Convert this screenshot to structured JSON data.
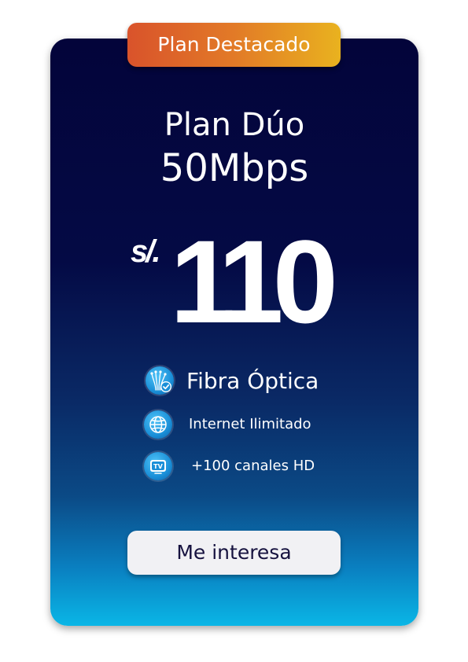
{
  "badge": {
    "label": "Plan Destacado"
  },
  "plan": {
    "name": "Plan Dúo",
    "speed": "50Mbps",
    "currency": "s/.",
    "price": "110"
  },
  "features": [
    {
      "icon": "fiber-optic-icon",
      "label": "Fibra Óptica"
    },
    {
      "icon": "globe-icon",
      "label": "Internet Ilimitado"
    },
    {
      "icon": "tv-icon",
      "label": "+100 canales HD"
    }
  ],
  "cta": {
    "label": "Me interesa"
  },
  "colors": {
    "card_top": "#03043a",
    "card_bottom": "#0ab6e6",
    "badge_start": "#d9532b",
    "badge_end": "#e9b21f",
    "cta_bg": "#f1f1f4",
    "cta_text": "#16123f"
  }
}
